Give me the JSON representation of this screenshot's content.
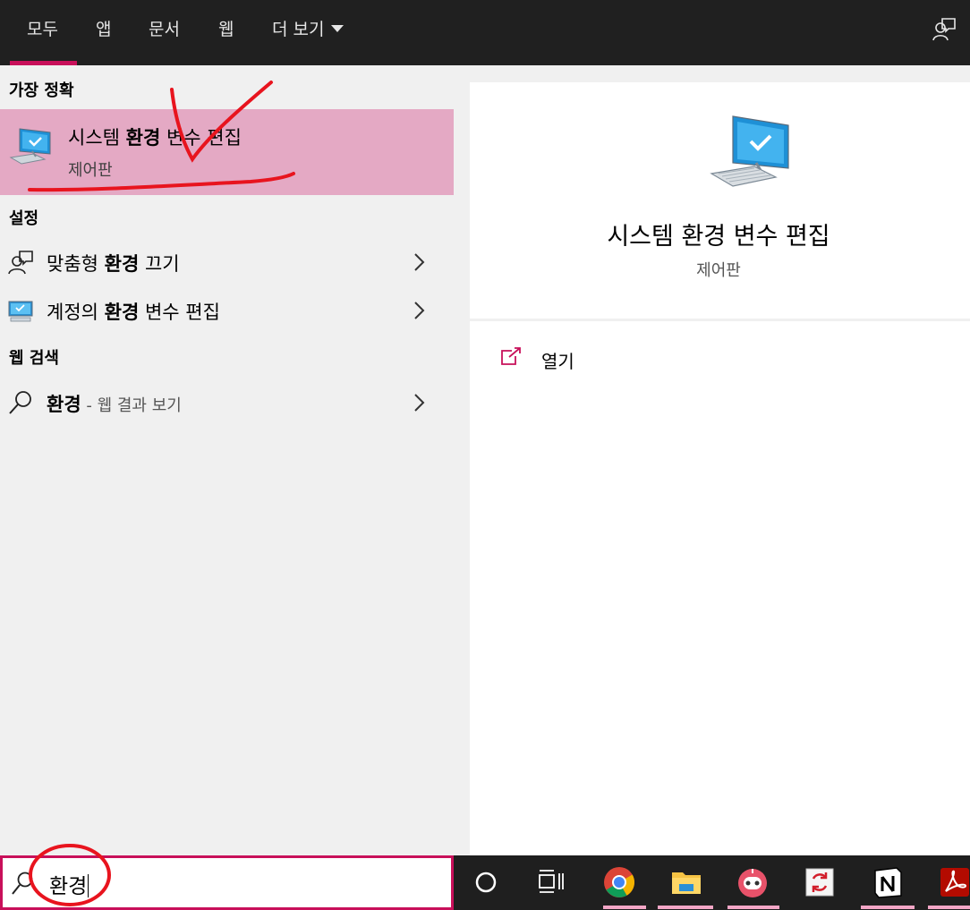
{
  "topbar": {
    "tabs": [
      {
        "label": "모두"
      },
      {
        "label": "앱"
      },
      {
        "label": "문서"
      },
      {
        "label": "웹"
      },
      {
        "label": "더 보기"
      }
    ],
    "feedback_icon": "feedback-icon"
  },
  "left": {
    "best_match": {
      "section": "가장 정확",
      "title_pre": "시스템 ",
      "title_bold": "환경",
      "title_post": " 변수 편집",
      "subtitle": "제어판",
      "icon": "system-monitor-icon"
    },
    "settings": {
      "section": "설정",
      "items": [
        {
          "pre": "맞춤형 ",
          "bold": "환경",
          "post": " 끄기",
          "icon": "person-chat-icon"
        },
        {
          "pre": "계정의 ",
          "bold": "환경",
          "post": " 변수 편집",
          "icon": "monitor-icon"
        }
      ]
    },
    "web": {
      "section": "웹 검색",
      "item": {
        "bold": "환경",
        "sep": " - ",
        "muted": "웹 결과 보기",
        "icon": "search-icon"
      }
    }
  },
  "right": {
    "title": "시스템 환경 변수 편집",
    "subtitle": "제어판",
    "open_label": "열기"
  },
  "search": {
    "value": "환경"
  },
  "taskbar": {
    "icons": [
      "cortana-icon",
      "task-view-icon",
      "chrome-icon",
      "file-explorer-icon",
      "robot-app-icon",
      "sync-app-icon",
      "notion-icon",
      "acrobat-icon"
    ]
  },
  "colors": {
    "accent": "#c8105a",
    "highlight": "#e4a9c4",
    "annotation": "#e8141e"
  }
}
